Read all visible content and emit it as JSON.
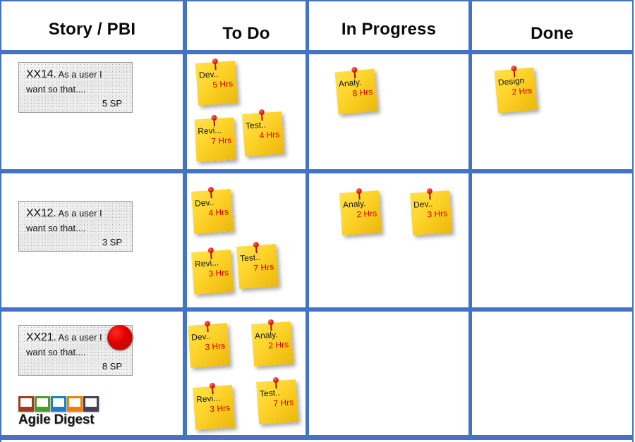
{
  "board": {
    "accent_color": "#4472C4",
    "note_color": "#FFD62E",
    "hours_color": "#D40000",
    "pin_color": "#E02818",
    "columns": [
      {
        "key": "story",
        "label": "Story / PBI"
      },
      {
        "key": "todo",
        "label": "To Do"
      },
      {
        "key": "inprogress",
        "label": "In Progress"
      },
      {
        "key": "done",
        "label": "Done"
      }
    ]
  },
  "rows": [
    {
      "story": {
        "id": "XX14.",
        "line1": "As a user I",
        "line2": "want  so that....",
        "points": "5 SP",
        "marker": null
      },
      "todo": [
        {
          "title": "Dev..",
          "hours": "5 Hrs"
        },
        {
          "title": "Revi...",
          "hours": "7 Hrs"
        },
        {
          "title": "Test..",
          "hours": "4 Hrs"
        }
      ],
      "inprogress": [
        {
          "title": "Analy.",
          "hours": "8 Hrs"
        }
      ],
      "done": [
        {
          "title": "Design",
          "hours": "2 Hrs"
        }
      ]
    },
    {
      "story": {
        "id": "XX12.",
        "line1": "As a user I",
        "line2": "want  so that....",
        "points": "3 SP",
        "marker": null
      },
      "todo": [
        {
          "title": "Dev..",
          "hours": "4 Hrs"
        },
        {
          "title": "Revi...",
          "hours": "3 Hrs"
        },
        {
          "title": "Test..",
          "hours": "7 Hrs"
        }
      ],
      "inprogress": [
        {
          "title": "Analy.",
          "hours": "2 Hrs"
        },
        {
          "title": "Dev..",
          "hours": "3 Hrs"
        }
      ],
      "done": []
    },
    {
      "story": {
        "id": "XX21.",
        "line1": "As a user I",
        "line2": "want  so that....",
        "points": "8 SP",
        "marker": "red-ball"
      },
      "todo": [
        {
          "title": "Dev..",
          "hours": "3 Hrs"
        },
        {
          "title": "Analy.",
          "hours": "2 Hrs"
        },
        {
          "title": "Revi...",
          "hours": "3 Hrs"
        },
        {
          "title": "Test..",
          "hours": "7 Hrs"
        }
      ],
      "inprogress": [],
      "done": []
    }
  ],
  "logo": {
    "text": "Agile Digest",
    "frame_colors": [
      "#A23A1B",
      "#4E9A2F",
      "#1E7FC2",
      "#F08000",
      "#4A3E52"
    ]
  }
}
